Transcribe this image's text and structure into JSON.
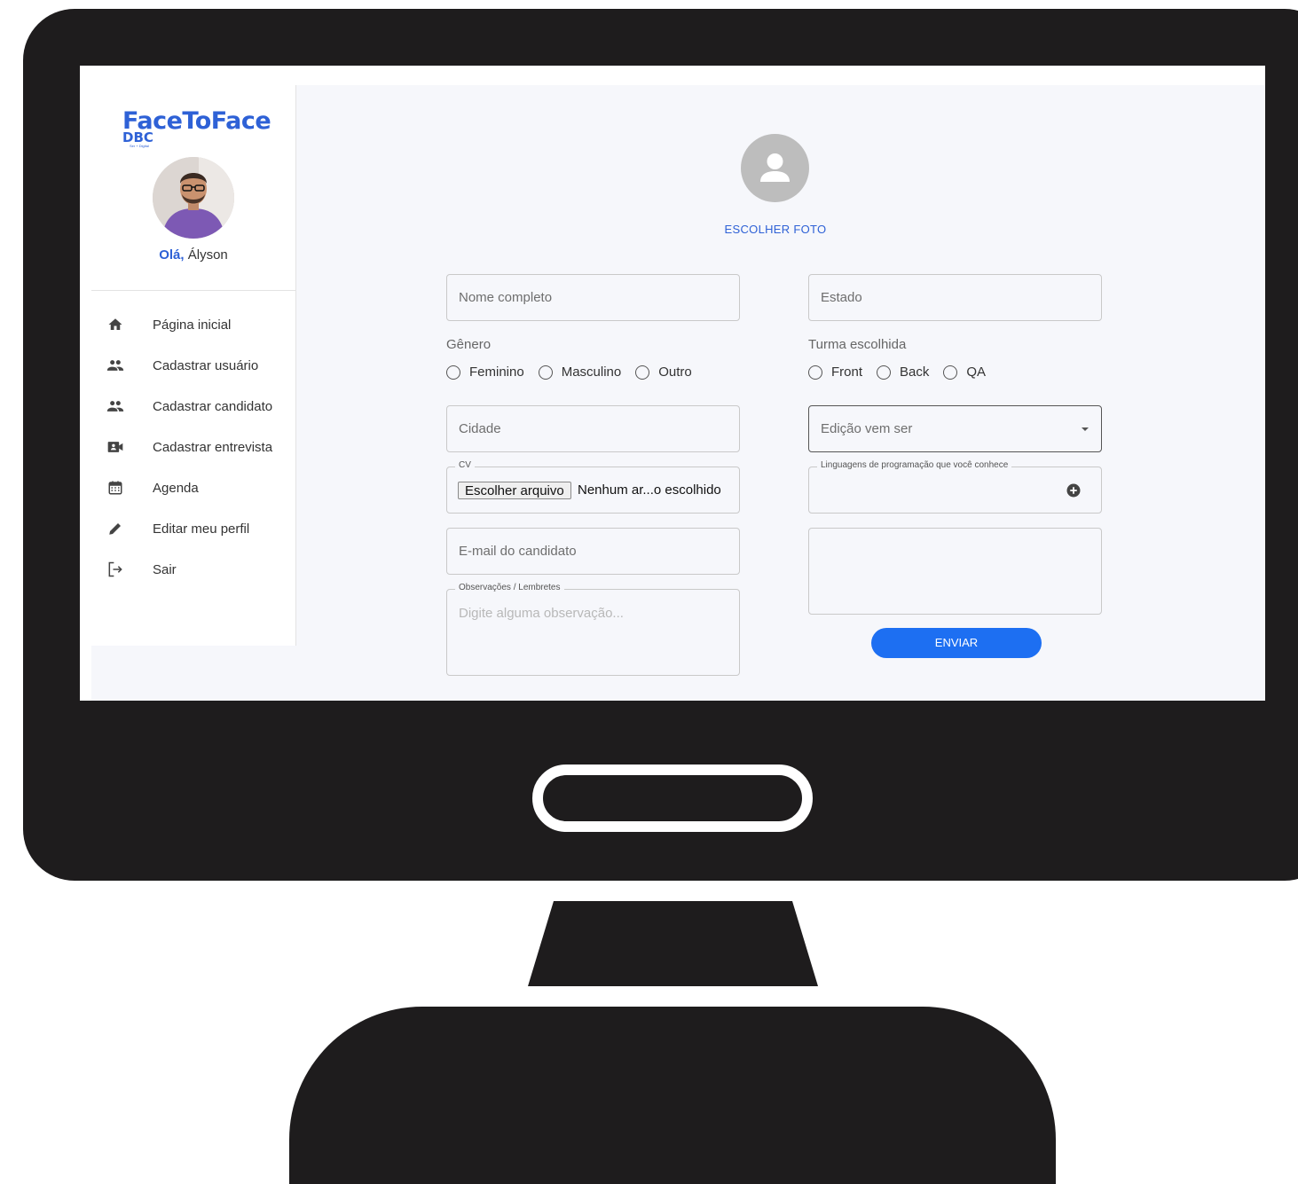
{
  "brand": {
    "title": "FaceToFace",
    "sub": "DBC",
    "tagline": "Ser + Digital"
  },
  "user": {
    "greeting_prefix": "Olá,",
    "name": "Ályson"
  },
  "sidebar": {
    "items": [
      {
        "label": "Página inicial",
        "icon": "home-icon"
      },
      {
        "label": "Cadastrar usuário",
        "icon": "people-icon"
      },
      {
        "label": "Cadastrar candidato",
        "icon": "people-icon"
      },
      {
        "label": "Cadastrar entrevista",
        "icon": "video-icon"
      },
      {
        "label": "Agenda",
        "icon": "calendar-icon"
      },
      {
        "label": "Editar meu perfil",
        "icon": "pencil-icon"
      },
      {
        "label": "Sair",
        "icon": "logout-icon"
      }
    ]
  },
  "form": {
    "photo_button": "ESCOLHER FOTO",
    "nome_placeholder": "Nome completo",
    "genero_label": "Gênero",
    "genero_options": [
      "Feminino",
      "Masculino",
      "Outro"
    ],
    "cidade_placeholder": "Cidade",
    "cv_legend": "CV",
    "cv_button": "Escolher arquivo",
    "cv_filename": "Nenhum ar...o escolhido",
    "email_placeholder": "E-mail do candidato",
    "obs_legend": "Observações / Lembretes",
    "obs_placeholder": "Digite alguma observação...",
    "estado_placeholder": "Estado",
    "turma_label": "Turma escolhida",
    "turma_options": [
      "Front",
      "Back",
      "QA"
    ],
    "edicao_placeholder": "Edição vem ser",
    "linguagens_legend": "Linguagens de programação que você conhece",
    "submit_label": "ENVIAR"
  },
  "colors": {
    "accent": "#2e61d6",
    "button": "#1d6ff2",
    "frame": "#1e1c1d",
    "background": "#f6f7fb"
  }
}
